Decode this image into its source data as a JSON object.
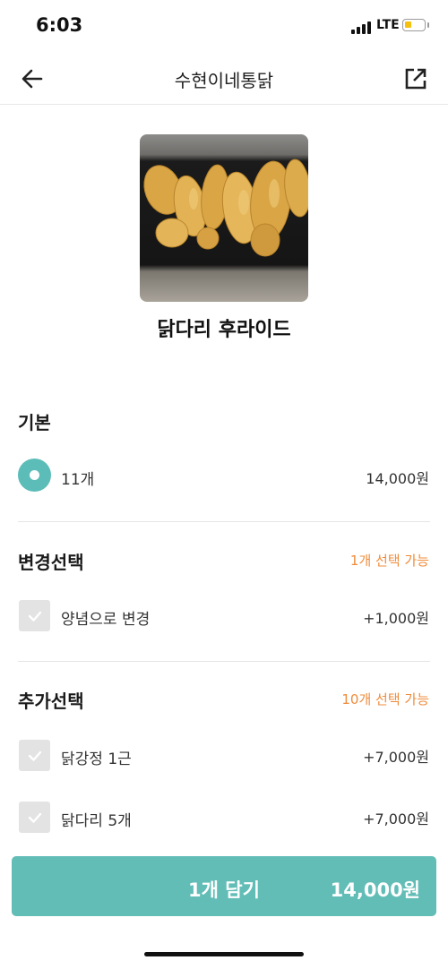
{
  "status_bar": {
    "time": "6:03",
    "network": "LTE",
    "battery_level": 0.3,
    "battery_color": "#f4c20d"
  },
  "header": {
    "title": "수현이네통닭",
    "back_icon": "arrow-left-icon",
    "share_icon": "share-external-icon"
  },
  "product": {
    "name": "닭다리 후라이드",
    "image": "fried-chicken-drumsticks-photo"
  },
  "sections": {
    "basic": {
      "title": "기본",
      "options": [
        {
          "label": "11개",
          "price": "14,000원",
          "selected": true
        }
      ]
    },
    "change": {
      "title": "변경선택",
      "limit": "1개 선택 가능",
      "options": [
        {
          "label": "양념으로 변경",
          "price": "+1,000원",
          "checked": false
        }
      ]
    },
    "extra": {
      "title": "추가선택",
      "limit": "10개 선택 가능",
      "options": [
        {
          "label": "닭강정 1근",
          "price": "+7,000원",
          "checked": false
        },
        {
          "label": "닭다리 5개",
          "price": "+7,000원",
          "checked": false
        }
      ]
    }
  },
  "cart_button": {
    "label": "1개 담기",
    "price": "14,000원",
    "color": "#63bdb7"
  },
  "colors": {
    "accent": "#5bbcb8",
    "limit_text": "#ef8c3c"
  }
}
